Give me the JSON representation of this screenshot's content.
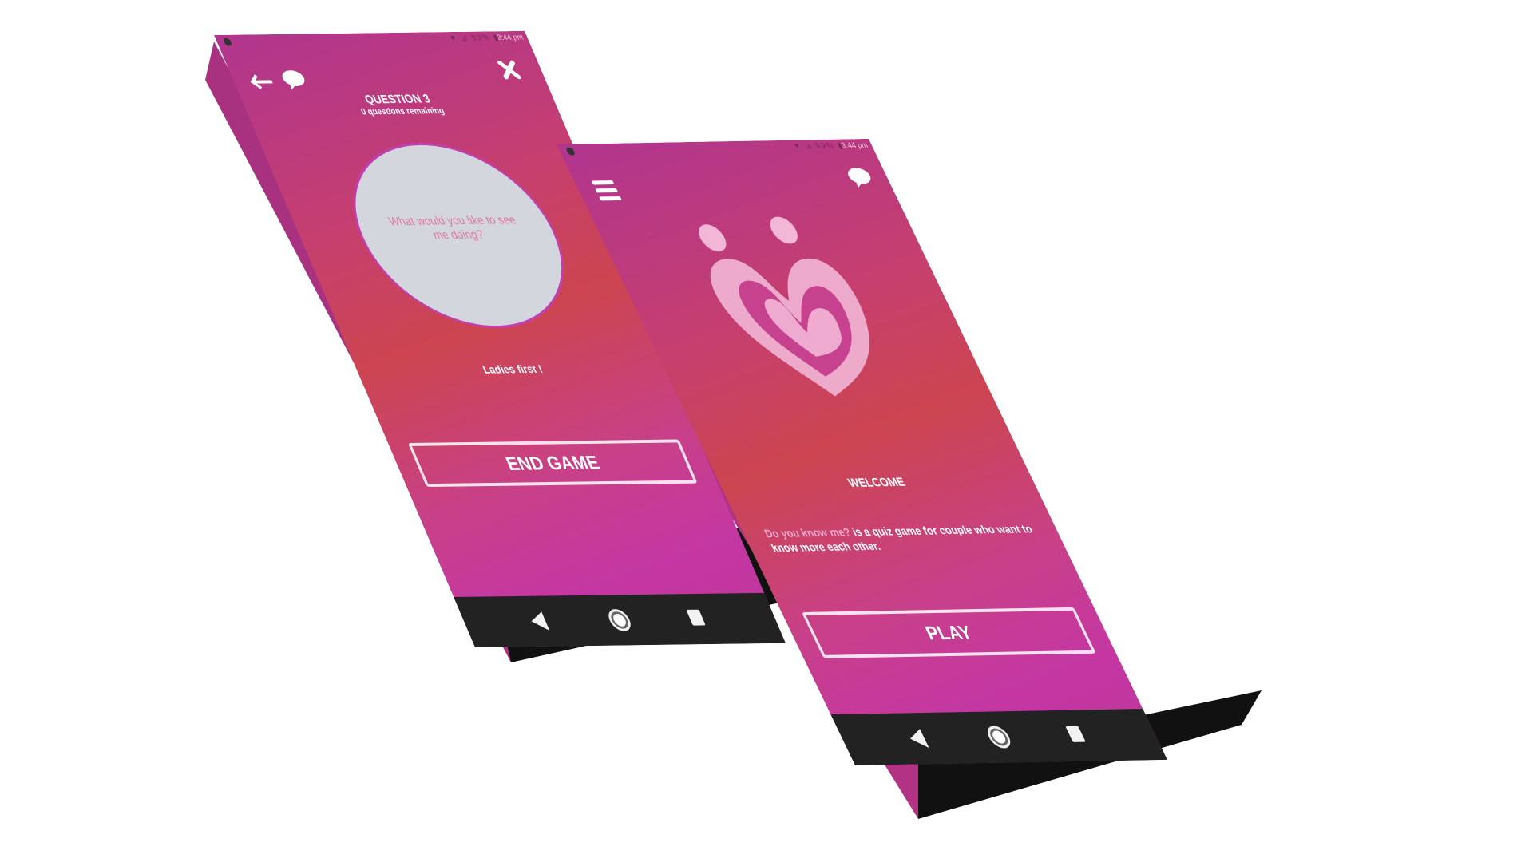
{
  "status_bar": {
    "icons": "▼ ⊿ 99% ▮",
    "time": "3:44 pm"
  },
  "question_screen": {
    "back_icon": "arrow-left-icon",
    "chat_icon": "chat-bubble-icon",
    "close_icon": "close-icon",
    "question_title": "QUESTION 3",
    "questions_remaining": "0 questions remaining",
    "question_text": "What would you like to see me doing?",
    "turn_label": "Ladies first !",
    "end_game_label": "END GAME"
  },
  "welcome_screen": {
    "menu_icon": "hamburger-menu-icon",
    "chat_icon": "chat-bubble-icon",
    "logo_icon": "couple-heart-logo-icon",
    "welcome_title": "WELCOME",
    "description_highlight": "Do you know me?",
    "description_rest": " is a quiz game for couple who want to know more each other.",
    "play_label": "PLAY"
  },
  "navigation": {
    "back": "back-triangle-icon",
    "home": "home-circle-icon",
    "recent": "recent-apps-square-icon"
  },
  "colors": {
    "gradient_top": "#b0358f",
    "gradient_mid": "#cc4550",
    "gradient_bottom": "#c0359b",
    "nav_bar": "#222222",
    "question_bubble": "#d3d6dc",
    "question_text": "#e07aa6",
    "highlight_text": "#f3a6cf",
    "logo_light": "#f2b6d6"
  }
}
